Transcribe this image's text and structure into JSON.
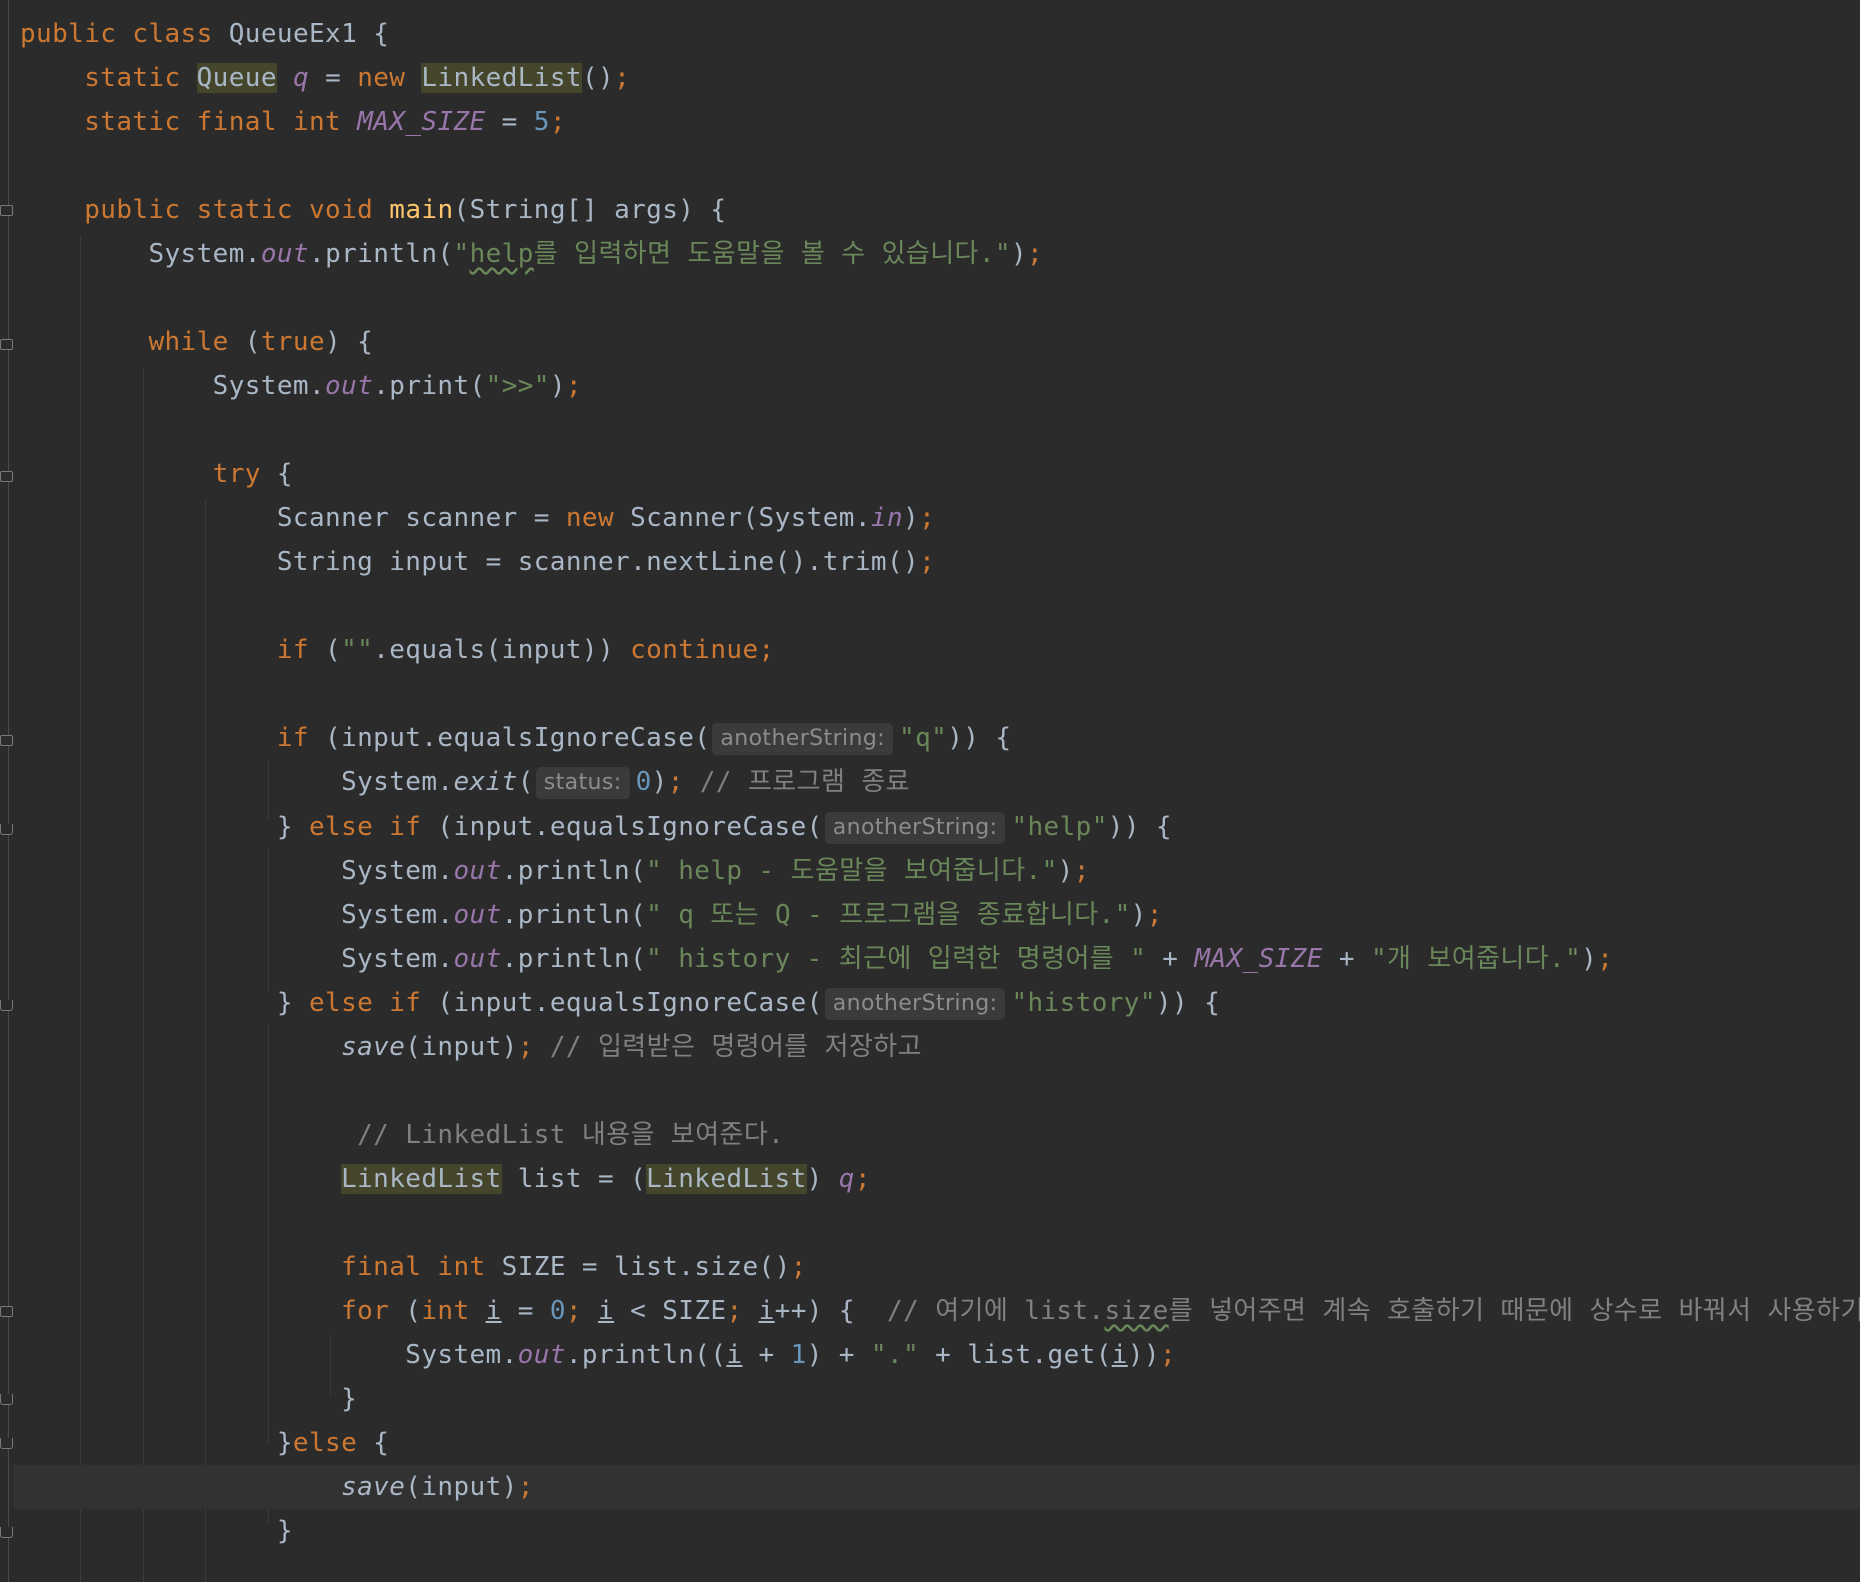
{
  "editor": {
    "language": "Java",
    "colors": {
      "background": "#2b2b2b",
      "text": "#a9b7c6",
      "keyword": "#cc7832",
      "string": "#6a8759",
      "number": "#6897bb",
      "comment": "#808080",
      "field": "#9876aa",
      "method_declaration": "#ffc66d",
      "highlight": "#45452b",
      "inlay_hint_bg": "#3b3b3b"
    },
    "caret_line": 34,
    "code": {
      "kw_public": "public",
      "kw_class": "class",
      "kw_static": "static",
      "kw_new": "new",
      "kw_final": "final",
      "kw_int": "int",
      "kw_void": "void",
      "kw_while": "while",
      "kw_true": "true",
      "kw_try": "try",
      "kw_if": "if",
      "kw_else": "else",
      "kw_continue": "continue",
      "kw_for": "for",
      "class_name": "QueueEx1",
      "type_queue": "Queue",
      "type_linkedlist": "LinkedList",
      "type_string": "String",
      "type_scanner": "Scanner",
      "type_system": "System",
      "field_q": "q",
      "const_max_size": "MAX_SIZE",
      "field_out": "out",
      "field_in": "in",
      "method_main": "main",
      "method_println": "println",
      "method_print": "print",
      "method_nextline": "nextLine",
      "method_trim": "trim",
      "method_equals": "equals",
      "method_equalsignorecase": "equalsIgnoreCase",
      "method_exit": "exit",
      "method_save": "save",
      "method_size": "size",
      "method_get": "get",
      "var_args": "args",
      "var_scanner": "scanner",
      "var_input": "input",
      "var_list": "list",
      "const_size": "SIZE",
      "var_i": "i",
      "num_5": "5",
      "num_0": "0",
      "num_1": "1",
      "str_help_intro_a": "\"",
      "str_help_word": "help",
      "str_help_intro_b": "를 입력하면 도움말을 볼 수 있습니다.\"",
      "str_prompt": "\">>\"",
      "str_empty": "\"\"",
      "str_q": "\"q\"",
      "str_help": "\"help\"",
      "str_help_desc": "\" help - 도움말을 보여줍니다.\"",
      "str_q_desc": "\" q 또는 Q - 프로그램을 종료합니다.\"",
      "str_history_desc": "\" history - 최근에 입력한 명령어를 \"",
      "str_history_desc2": "\"개 보여줍니다.\"",
      "str_history": "\"history\"",
      "str_dot": "\".\"",
      "hint_anotherstring": "anotherString:",
      "hint_status": "status:",
      "cmt_exit": "// 프로그램 종료",
      "cmt_save": "// 입력받은 명령어를 저장하고",
      "cmt_show": "// LinkedList 내용을 보여준다.",
      "cmt_for_a": "// 여기에 list.",
      "cmt_for_size": "size",
      "cmt_for_b": "를 넣어주면 계속 호출하기 때문에 상수로 바꿔서 사용하기"
    }
  }
}
